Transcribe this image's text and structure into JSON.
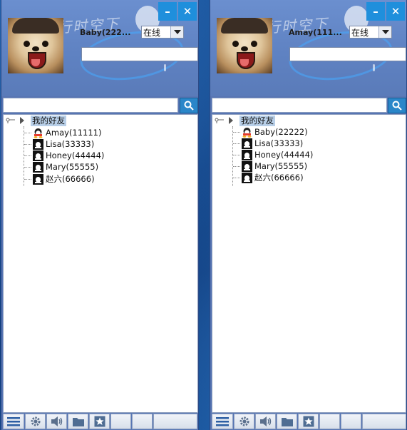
{
  "windows": [
    {
      "nickname": "Baby(222...",
      "status": "在线",
      "signature": "",
      "search_value": "",
      "minimize_label": "–",
      "close_label": "✕",
      "group": "我的好友",
      "friends": [
        {
          "name": "Amay(11111)",
          "online": true
        },
        {
          "name": "Lisa(33333)",
          "online": false
        },
        {
          "name": "Honey(44444)",
          "online": false
        },
        {
          "name": "Mary(55555)",
          "online": false
        },
        {
          "name": "赵六(66666)",
          "online": false
        }
      ]
    },
    {
      "nickname": "Amay(111...",
      "status": "在线",
      "signature": "",
      "search_value": "",
      "minimize_label": "–",
      "close_label": "✕",
      "group": "我的好友",
      "friends": [
        {
          "name": "Baby(22222)",
          "online": true
        },
        {
          "name": "Lisa(33333)",
          "online": false
        },
        {
          "name": "Honey(44444)",
          "online": false
        },
        {
          "name": "Mary(55555)",
          "online": false
        },
        {
          "name": "赵六(66666)",
          "online": false
        }
      ]
    }
  ],
  "header_doodle_text": "行时空下",
  "toolbar_icons": [
    "menu-icon",
    "gear-icon",
    "speaker-icon",
    "folder-icon",
    "star-icon"
  ],
  "colors": {
    "accent": "#1f8fdc",
    "header": "#5f82c2",
    "group_highlight": "#b8cfe8"
  }
}
